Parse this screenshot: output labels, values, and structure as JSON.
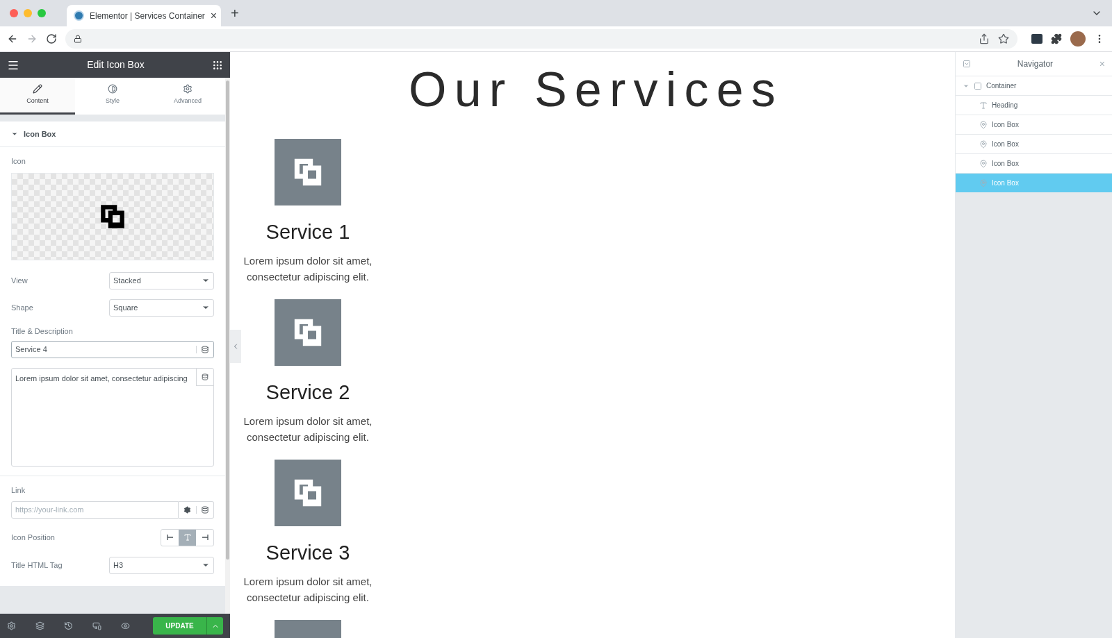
{
  "browser": {
    "tab_title": "Elementor | Services Container",
    "close": "×",
    "new_tab": "+"
  },
  "panel": {
    "title": "Edit Icon Box",
    "tabs": [
      {
        "label": "Content",
        "kind": "pencil",
        "selected": true
      },
      {
        "label": "Style",
        "kind": "contrast",
        "selected": false
      },
      {
        "label": "Advanced",
        "kind": "gear",
        "selected": false
      }
    ],
    "section": {
      "title": "Icon Box",
      "expanded": true
    },
    "icon_label": "Icon",
    "view": {
      "label": "View",
      "value": "Stacked"
    },
    "shape": {
      "label": "Shape",
      "value": "Square"
    },
    "title_description": {
      "label": "Title & Description",
      "title_value": "Service 4",
      "description_value": "Lorem ipsum dolor sit amet, consectetur adipiscing"
    },
    "link": {
      "label": "Link",
      "placeholder": "https://your-link.com"
    },
    "icon_position": {
      "label": "Icon Position",
      "options": [
        {
          "kind": "left",
          "selected": false
        },
        {
          "kind": "top",
          "selected": true
        },
        {
          "kind": "right",
          "selected": false
        }
      ]
    },
    "title_tag": {
      "label": "Title HTML Tag",
      "value": "H3"
    },
    "update_button": "UPDATE"
  },
  "preview": {
    "heading": "Our Services",
    "services": [
      {
        "title": "Service 1",
        "text": "Lorem ipsum dolor sit amet, consectetur adipiscing elit."
      },
      {
        "title": "Service 2",
        "text": "Lorem ipsum dolor sit amet, consectetur adipiscing elit."
      },
      {
        "title": "Service 3",
        "text": "Lorem ipsum dolor sit amet, consectetur adipiscing elit."
      }
    ]
  },
  "navigator": {
    "title": "Navigator",
    "close": "×",
    "tree": [
      {
        "label": "Container",
        "kind": "container",
        "expanded": true,
        "selected": false,
        "children": [
          {
            "label": "Heading",
            "kind": "heading",
            "selected": false
          },
          {
            "label": "Icon Box",
            "kind": "iconbox",
            "selected": false
          },
          {
            "label": "Icon Box",
            "kind": "iconbox",
            "selected": false
          },
          {
            "label": "Icon Box",
            "kind": "iconbox",
            "selected": false
          },
          {
            "label": "Icon Box",
            "kind": "iconbox",
            "selected": true
          }
        ]
      }
    ]
  }
}
